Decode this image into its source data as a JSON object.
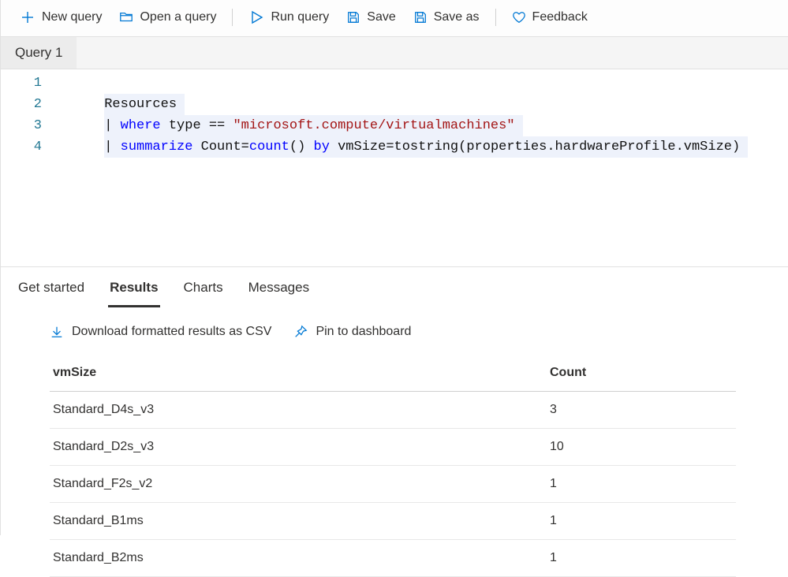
{
  "toolbar": {
    "new_query": "New query",
    "open_query": "Open a query",
    "run_query": "Run query",
    "save": "Save",
    "save_as": "Save as",
    "feedback": "Feedback"
  },
  "query_tab": {
    "label": "Query 1"
  },
  "editor": {
    "line_numbers": [
      "1",
      "2",
      "3",
      "4"
    ],
    "line1": {
      "text": "Resources"
    },
    "line2": {
      "pipe": "| ",
      "kw": "where",
      "mid": " type == ",
      "str": "\"microsoft.compute/virtualmachines\""
    },
    "line3": {
      "pipe": "| ",
      "kw": "summarize",
      "seg1": " Count=",
      "fn": "count",
      "seg2": "() ",
      "kw2": "by",
      "seg3": " vmSize=tostring(properties.hardwareProfile.vmSize)"
    }
  },
  "result_tabs": {
    "get_started": "Get started",
    "results": "Results",
    "charts": "Charts",
    "messages": "Messages"
  },
  "result_actions": {
    "download_csv": "Download formatted results as CSV",
    "pin_dashboard": "Pin to dashboard"
  },
  "table": {
    "headers": {
      "vmSize": "vmSize",
      "count": "Count"
    },
    "rows": [
      {
        "vmSize": "Standard_D4s_v3",
        "count": "3"
      },
      {
        "vmSize": "Standard_D2s_v3",
        "count": "10"
      },
      {
        "vmSize": "Standard_F2s_v2",
        "count": "1"
      },
      {
        "vmSize": "Standard_B1ms",
        "count": "1"
      },
      {
        "vmSize": "Standard_B2ms",
        "count": "1"
      }
    ]
  }
}
